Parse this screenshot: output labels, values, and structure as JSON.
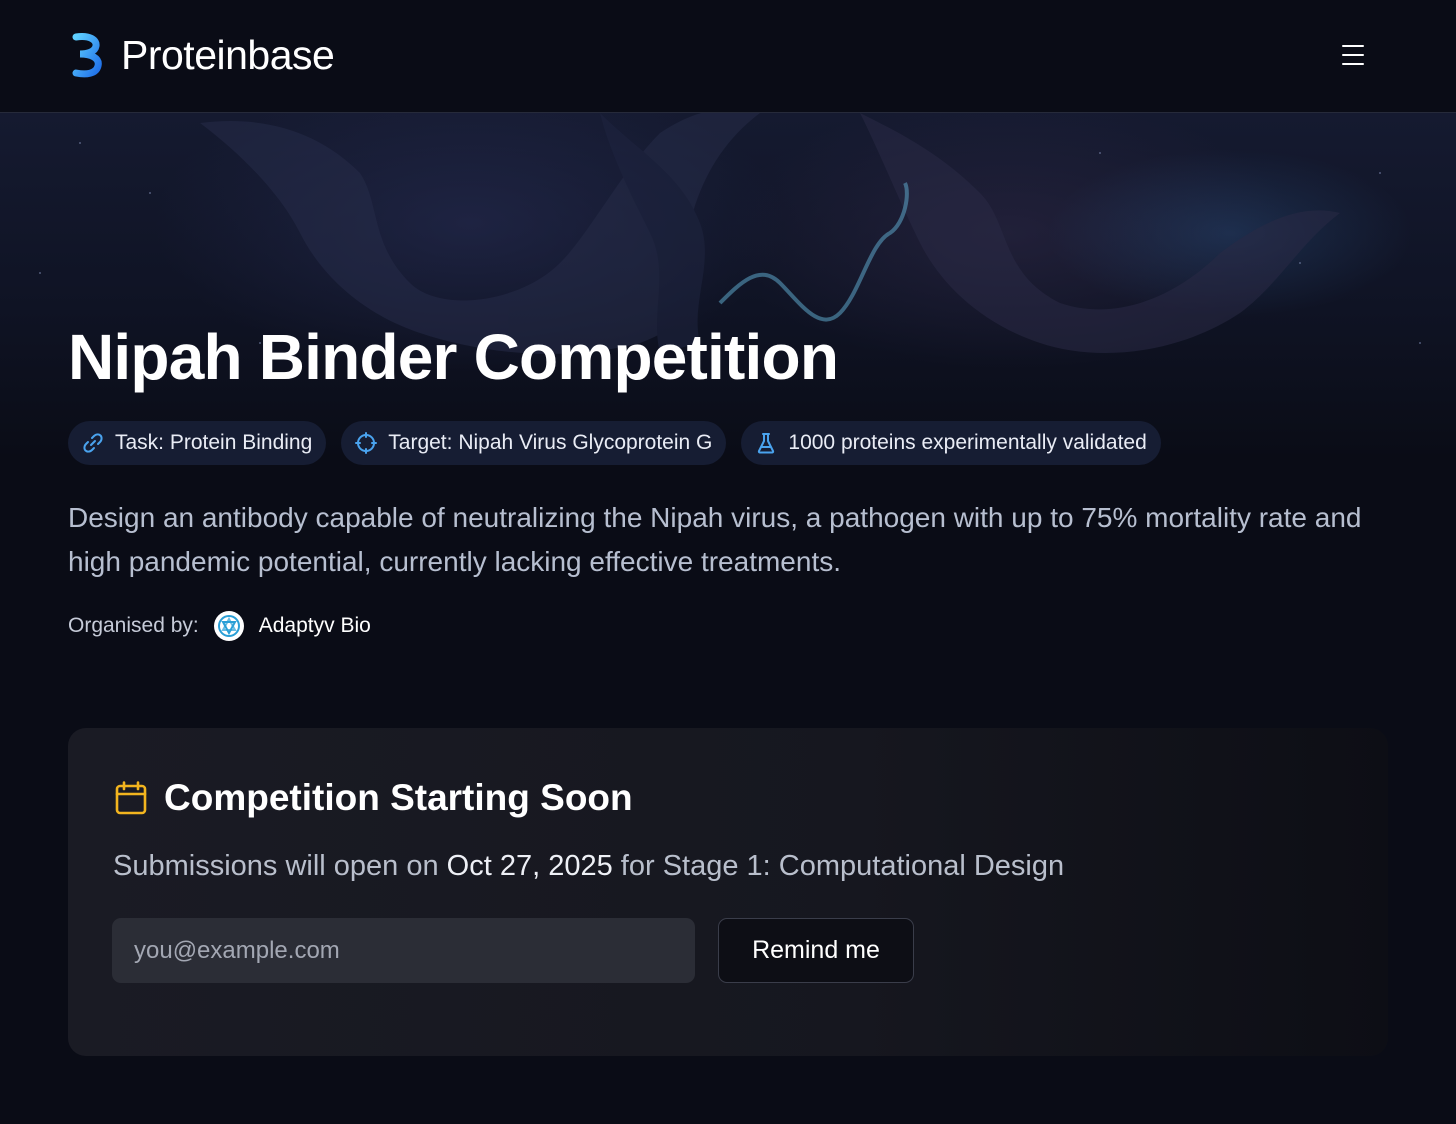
{
  "header": {
    "brand_name": "Proteinbase",
    "logo_icon": "proteinbase-logo-icon",
    "menu_icon": "hamburger-menu-icon"
  },
  "hero": {
    "title": "Nipah Binder Competition",
    "tags": [
      {
        "icon": "link-icon",
        "label": "Task: Protein Binding"
      },
      {
        "icon": "target-icon",
        "label": "Target: Nipah Virus Glycoprotein G"
      },
      {
        "icon": "flask-icon",
        "label": "1000 proteins experimentally validated"
      }
    ],
    "description": "Design an antibody capable of neutralizing the Nipah virus, a pathogen with up to 75% mortality rate and high pandemic potential, currently lacking effective treatments.",
    "organiser": {
      "label": "Organised by:",
      "name": "Adaptyv Bio",
      "avatar_icon": "adaptyv-bio-logo-icon"
    }
  },
  "competition_card": {
    "icon": "calendar-icon",
    "title": "Competition Starting Soon",
    "text_before": "Submissions will open on ",
    "date": "Oct 27, 2025",
    "text_after": " for Stage 1: Computational Design",
    "email_placeholder": "you@example.com",
    "email_value": "",
    "button_label": "Remind me"
  },
  "colors": {
    "background": "#0a0c16",
    "brand_blue": "#2a8cf0",
    "tag_icon_blue": "#4aa3ee",
    "calendar_yellow": "#f3b51f",
    "card_background": "#1a1b24"
  }
}
